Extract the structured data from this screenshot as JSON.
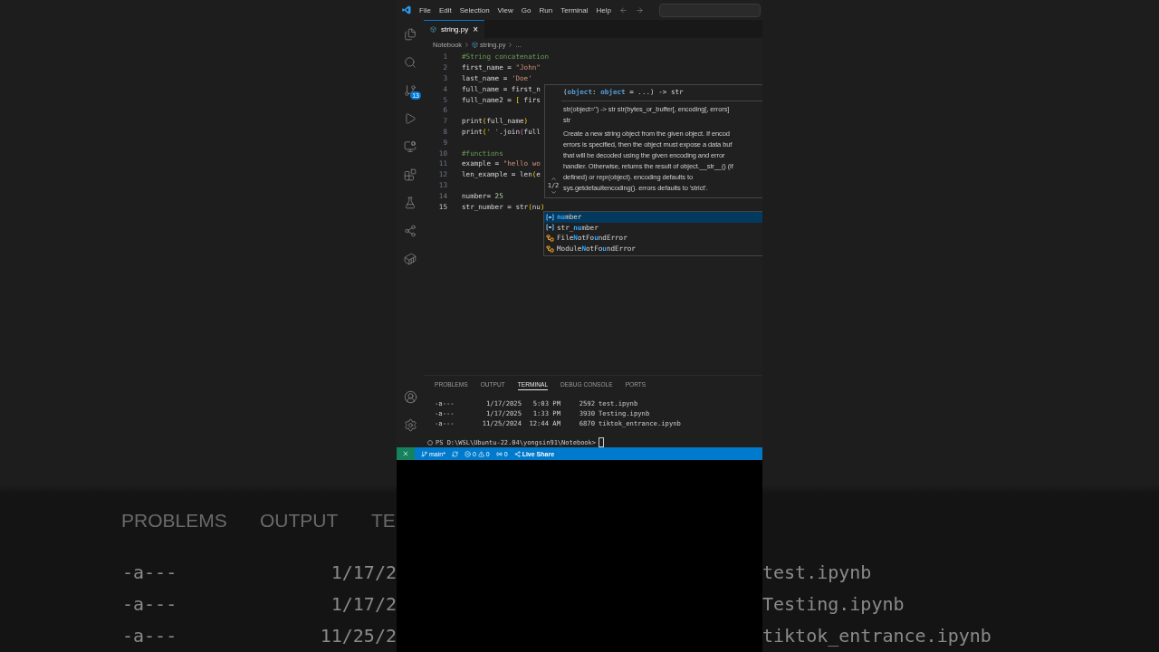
{
  "backdrop": {
    "panel_tabs": [
      "PROBLEMS",
      "OUTPUT",
      "TE"
    ],
    "rows": [
      {
        "mode": "-a---",
        "date": "1/17/2",
        "name": "test.ipynb"
      },
      {
        "mode": "-a---",
        "date": "1/17/2",
        "name": "Testing.ipynb"
      },
      {
        "mode": "-a---",
        "date": "11/25/2",
        "name": "tiktok_entrance.ipynb"
      }
    ]
  },
  "menu": [
    "File",
    "Edit",
    "Selection",
    "View",
    "Go",
    "Run",
    "Terminal",
    "Help"
  ],
  "activity_bar": {
    "items": [
      {
        "kind": "explorer",
        "selected": false
      },
      {
        "kind": "search",
        "selected": false
      },
      {
        "kind": "source-control",
        "selected": false,
        "badge": "13"
      },
      {
        "kind": "run",
        "selected": false
      },
      {
        "kind": "remote",
        "selected": false
      },
      {
        "kind": "extensions",
        "selected": false
      },
      {
        "kind": "testing",
        "selected": false
      },
      {
        "kind": "live-share",
        "selected": false
      },
      {
        "kind": "docker",
        "selected": false
      }
    ],
    "bottom": [
      {
        "kind": "account"
      },
      {
        "kind": "settings"
      }
    ]
  },
  "tab": {
    "label": "string.py",
    "close": "×"
  },
  "breadcrumb": [
    "Notebook",
    "string.py",
    "..."
  ],
  "lines": [
    {
      "number": "1",
      "current": false,
      "segments": [
        {
          "text": "#String concatenation",
          "kind": "comment"
        }
      ]
    },
    {
      "number": "2",
      "current": false,
      "segments": [
        {
          "text": "first_name = ",
          "kind": "plain"
        },
        {
          "text": "\"John\"",
          "kind": "string"
        }
      ]
    },
    {
      "number": "3",
      "current": false,
      "segments": [
        {
          "text": "last_name = ",
          "kind": "plain"
        },
        {
          "text": "'Doe'",
          "kind": "string"
        }
      ]
    },
    {
      "number": "4",
      "current": false,
      "segments": [
        {
          "text": "full_name = first_n",
          "kind": "plain"
        }
      ]
    },
    {
      "number": "5",
      "current": false,
      "segments": [
        {
          "text": "full_name2 = ",
          "kind": "plain"
        },
        {
          "text": "[",
          "kind": "bracket"
        },
        {
          "text": " firs",
          "kind": "plain"
        }
      ]
    },
    {
      "number": "6",
      "current": false
    },
    {
      "number": "7",
      "current": false,
      "segments": [
        {
          "text": "print",
          "kind": "plain"
        },
        {
          "text": "(",
          "kind": "bracket"
        },
        {
          "text": "full_name",
          "kind": "plain"
        },
        {
          "text": ")",
          "kind": "bracket"
        }
      ]
    },
    {
      "number": "8",
      "current": false,
      "segments": [
        {
          "text": "print",
          "kind": "plain"
        },
        {
          "text": "(",
          "kind": "bracket"
        },
        {
          "text": "' '",
          "kind": "string"
        },
        {
          "text": ".join",
          "kind": "plain"
        },
        {
          "text": "(",
          "kind": "bracket2"
        },
        {
          "text": "full",
          "kind": "plain"
        }
      ]
    },
    {
      "number": "9",
      "current": false
    },
    {
      "number": "10",
      "current": false,
      "segments": [
        {
          "text": "#functions",
          "kind": "comment"
        }
      ]
    },
    {
      "number": "11",
      "current": false,
      "segments": [
        {
          "text": "example = ",
          "kind": "plain"
        },
        {
          "text": "\"hello wo",
          "kind": "string"
        }
      ]
    },
    {
      "number": "12",
      "current": false,
      "segments": [
        {
          "text": "len_example = len",
          "kind": "plain"
        },
        {
          "text": "(",
          "kind": "bracket"
        },
        {
          "text": "e",
          "kind": "plain"
        }
      ]
    },
    {
      "number": "13",
      "current": false
    },
    {
      "number": "14",
      "current": false,
      "segments": [
        {
          "text": "number= ",
          "kind": "plain"
        },
        {
          "text": "25",
          "kind": "number"
        }
      ]
    },
    {
      "number": "15",
      "current": true,
      "segments": [
        {
          "text": "str_number = str",
          "kind": "plain"
        },
        {
          "text": "(",
          "kind": "bracket"
        },
        {
          "text": "nu",
          "kind": "plain"
        },
        {
          "text": ")",
          "kind": "bracket"
        }
      ]
    }
  ],
  "hover": {
    "signature": [
      {
        "text": "(",
        "kind": "plain"
      },
      {
        "text": "object",
        "kind": "param"
      },
      {
        "text": ": ",
        "kind": "plain"
      },
      {
        "text": "object",
        "kind": "param"
      },
      {
        "text": " = ...) -> str",
        "kind": "plain"
      }
    ],
    "overload": "1/2",
    "doc": [
      "str(object='') -> str str(bytes_or_buffer[, encoding[, errors]",
      "str"
    ],
    "description": [
      "Create a new string object from the given object. If encod",
      "errors is specified, then the object must expose a data buf",
      "that will be decoded using the given encoding and error",
      "handler. Otherwise, returns the result of object.__str__() (if",
      "defined) or repr(object). encoding defaults to",
      "sys.getdefaultencoding(). errors defaults to 'strict'."
    ]
  },
  "suggestions": [
    {
      "kind": "variable",
      "selected": true,
      "parts": [
        {
          "text": "nu",
          "match": true
        },
        {
          "text": "mber",
          "match": false
        }
      ]
    },
    {
      "kind": "variable",
      "selected": false,
      "parts": [
        {
          "text": "str_",
          "match": false
        },
        {
          "text": "nu",
          "match": true
        },
        {
          "text": "mber",
          "match": false
        }
      ]
    },
    {
      "kind": "class",
      "selected": false,
      "parts": [
        {
          "text": "File",
          "match": false
        },
        {
          "text": "N",
          "match": true
        },
        {
          "text": "otFo",
          "match": false
        },
        {
          "text": "u",
          "match": true
        },
        {
          "text": "ndError",
          "match": false
        }
      ]
    },
    {
      "kind": "class",
      "selected": false,
      "parts": [
        {
          "text": "Module",
          "match": false
        },
        {
          "text": "N",
          "match": true
        },
        {
          "text": "otFo",
          "match": false
        },
        {
          "text": "u",
          "match": true
        },
        {
          "text": "ndError",
          "match": false
        }
      ]
    }
  ],
  "panel": {
    "tabs": [
      {
        "label": "PROBLEMS",
        "selected": false
      },
      {
        "label": "OUTPUT",
        "selected": false
      },
      {
        "label": "TERMINAL",
        "selected": true
      },
      {
        "label": "DEBUG CONSOLE",
        "selected": false
      },
      {
        "label": "PORTS",
        "selected": false
      }
    ],
    "rows": [
      {
        "mode": "-a---",
        "date": "1/17/2025",
        "time": "5:03 PM",
        "size": "2592",
        "name": "test.ipynb"
      },
      {
        "mode": "-a---",
        "date": "1/17/2025",
        "time": "1:33 PM",
        "size": "3930",
        "name": "Testing.ipynb"
      },
      {
        "mode": "-a---",
        "date": "11/25/2024",
        "time": "12:44 AM",
        "size": "6870",
        "name": "tiktok_entrance.ipynb"
      }
    ],
    "prompt": "PS D:\\WSL\\Ubuntu-22.04\\yongsin91\\Notebook>"
  },
  "status": {
    "branch": "main*",
    "errors": "0",
    "warnings": "0",
    "ports": "0",
    "live_share": "Live Share"
  }
}
